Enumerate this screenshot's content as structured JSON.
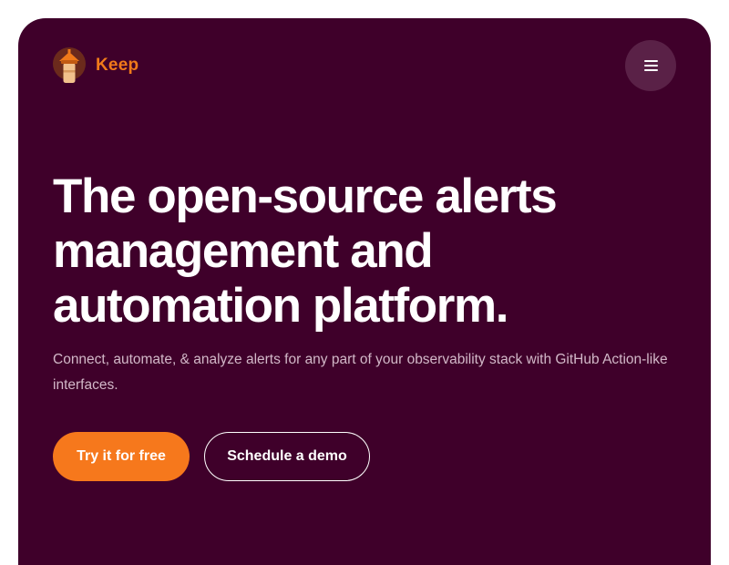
{
  "header": {
    "brand_name": "Keep",
    "logo_icon": "lighthouse-logo-icon",
    "menu_icon": "hamburger-menu-icon"
  },
  "hero": {
    "headline_lines": [
      "The open-source alerts",
      "management and",
      "automation platform."
    ],
    "subtitle": "Connect, automate, & analyze alerts for any part of your observability stack with GitHub Action-like interfaces.",
    "primary_cta": "Try it for free",
    "secondary_cta": "Schedule a demo"
  },
  "colors": {
    "page_background": "#ffffff",
    "hero_background": "#3f002a",
    "brand_orange": "#f6781c",
    "menu_button_background": "#5a2147",
    "subtitle_text": "#d2b8c8"
  }
}
